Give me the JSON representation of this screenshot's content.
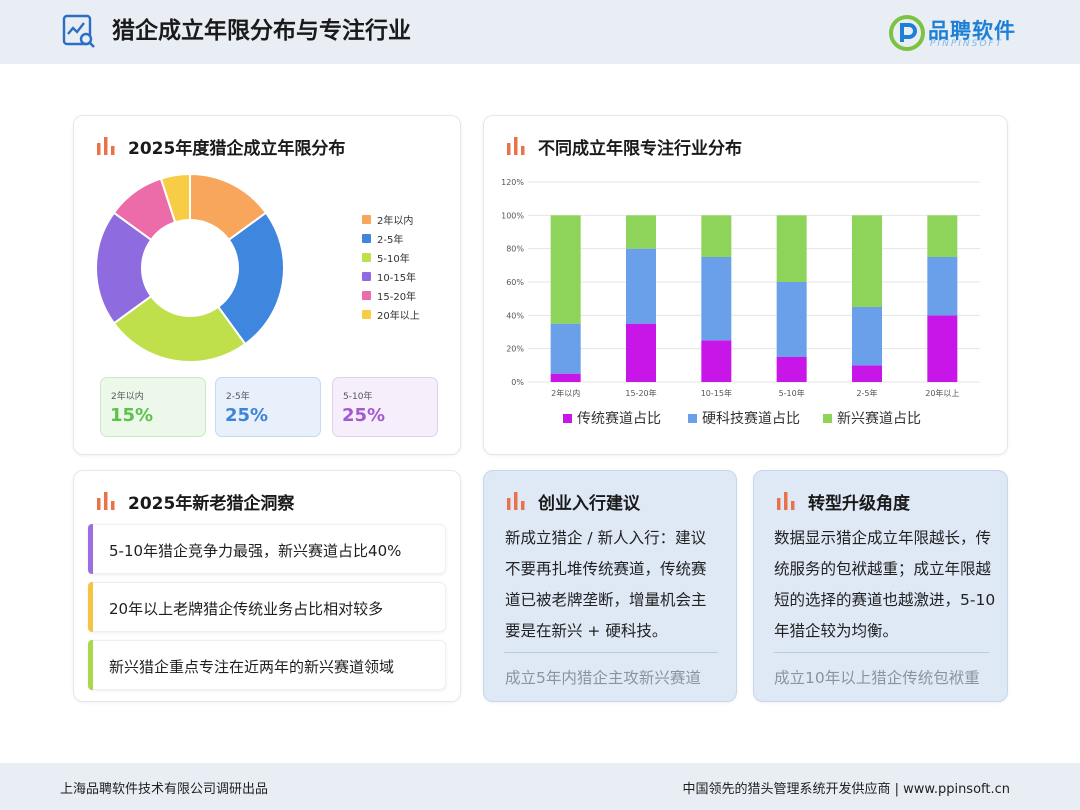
{
  "header": {
    "title": "猎企成立年限分布与专注行业",
    "logo_text": "品聘软件",
    "logo_sub": "PINPINSOFT"
  },
  "donut_card": {
    "title": "2025年度猎企成立年限分布"
  },
  "stats": [
    {
      "label": "2年以内",
      "value": "15%",
      "color": "#5cc24a",
      "bg": "#ecf8ea",
      "border": "#c9ebc3"
    },
    {
      "label": "2-5年",
      "value": "25%",
      "color": "#3e84d8",
      "bg": "#e8f0fb",
      "border": "#c6d9f3"
    },
    {
      "label": "5-10年",
      "value": "25%",
      "color": "#a25ad0",
      "bg": "#f6eefb",
      "border": "#e3cff1"
    }
  ],
  "bar_card": {
    "title": "不同成立年限专注行业分布"
  },
  "chart_data": [
    {
      "type": "pie",
      "title": "2025年度猎企成立年限分布",
      "donut": true,
      "categories": [
        "2年以内",
        "2-5年",
        "5-10年",
        "10-15年",
        "15-20年",
        "20年以上"
      ],
      "values": [
        15,
        25,
        25,
        20,
        10,
        5
      ],
      "colors": [
        "#f8a65c",
        "#3f86de",
        "#bfe04a",
        "#8e6cdf",
        "#ec6ba9",
        "#f8cc45"
      ],
      "legend": "right"
    },
    {
      "type": "bar",
      "stacked": true,
      "title": "不同成立年限专注行业分布",
      "categories": [
        "2年以内",
        "15-20年",
        "10-15年",
        "5-10年",
        "2-5年",
        "20年以上"
      ],
      "series": [
        {
          "name": "传统赛道占比",
          "color": "#c815e8",
          "values": [
            5,
            35,
            25,
            15,
            10,
            40
          ]
        },
        {
          "name": "硬科技赛道占比",
          "color": "#6a9fea",
          "values": [
            30,
            45,
            50,
            45,
            35,
            35
          ]
        },
        {
          "name": "新兴赛道占比",
          "color": "#8fd45a",
          "values": [
            65,
            20,
            25,
            40,
            55,
            25
          ]
        }
      ],
      "yticks": [
        "0%",
        "20%",
        "40%",
        "60%",
        "80%",
        "100%",
        "120%"
      ],
      "ylim": [
        0,
        120
      ],
      "grid": true,
      "legend": "bottom"
    }
  ],
  "insights": {
    "title": "2025年新老猎企洞察",
    "items": [
      {
        "text": "5-10年猎企竞争力最强，新兴赛道占比40%",
        "color": "#9b6ee0"
      },
      {
        "text": "20年以上老牌猎企传统业务占比相对较多",
        "color": "#f6c445"
      },
      {
        "text": "新兴猎企重点专注在近两年的新兴赛道领域",
        "color": "#a9d84c"
      }
    ]
  },
  "advice": {
    "title": "创业入行建议",
    "body": "新成立猎企 / 新人入行：建议不要再扎堆传统赛道，传统赛道已被老牌垄断，增量机会主要是在新兴 + 硬科技。",
    "footer": "成立5年内猎企主攻新兴赛道"
  },
  "transform": {
    "title": "转型升级角度",
    "body": "数据显示猎企成立年限越长，传统服务的包袱越重；成立年限越短的选择的赛道也越激进，5-10年猎企较为均衡。",
    "footer": "成立10年以上猎企传统包袱重"
  },
  "footer": {
    "left": "上海品聘软件技术有限公司调研出品",
    "right": "中国领先的猎头管理系统开发供应商 | www.ppinsoft.cn"
  },
  "colors": {
    "accent_icon": "#e8734a",
    "header_bg": "#e9eef5",
    "brand_blue": "#1e7fd6"
  }
}
